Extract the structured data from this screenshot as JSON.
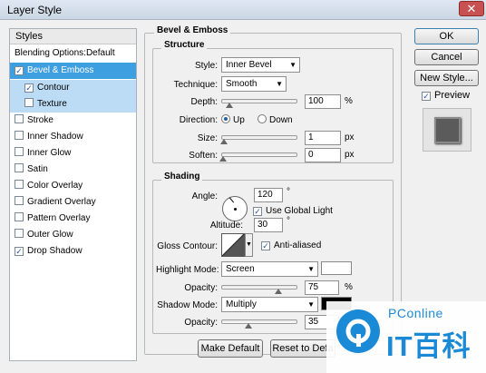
{
  "window": {
    "title": "Layer Style",
    "close_glyph": "✕"
  },
  "styles": {
    "header": "Styles",
    "blending_options": "Blending Options:Default",
    "items": [
      {
        "label": "Bevel & Emboss",
        "checked": true
      },
      {
        "label": "Contour",
        "checked": true
      },
      {
        "label": "Texture",
        "checked": false
      },
      {
        "label": "Stroke",
        "checked": false
      },
      {
        "label": "Inner Shadow",
        "checked": false
      },
      {
        "label": "Inner Glow",
        "checked": false
      },
      {
        "label": "Satin",
        "checked": false
      },
      {
        "label": "Color Overlay",
        "checked": false
      },
      {
        "label": "Gradient Overlay",
        "checked": false
      },
      {
        "label": "Pattern Overlay",
        "checked": false
      },
      {
        "label": "Outer Glow",
        "checked": false
      },
      {
        "label": "Drop Shadow",
        "checked": true
      }
    ]
  },
  "bevel": {
    "section_title": "Bevel & Emboss",
    "structure": {
      "title": "Structure",
      "style_label": "Style:",
      "style_value": "Inner Bevel",
      "technique_label": "Technique:",
      "technique_value": "Smooth",
      "depth_label": "Depth:",
      "depth_value": "100",
      "depth_unit": "%",
      "direction_label": "Direction:",
      "direction_up": "Up",
      "direction_down": "Down",
      "size_label": "Size:",
      "size_value": "1",
      "size_unit": "px",
      "soften_label": "Soften:",
      "soften_value": "0",
      "soften_unit": "px"
    },
    "shading": {
      "title": "Shading",
      "angle_label": "Angle:",
      "angle_value": "120",
      "angle_unit": "°",
      "global_light_label": "Use Global Light",
      "altitude_label": "Altitude:",
      "altitude_value": "30",
      "altitude_unit": "°",
      "gloss_label": "Gloss Contour:",
      "anti_aliased_label": "Anti-aliased",
      "highlight_mode_label": "Highlight Mode:",
      "highlight_mode_value": "Screen",
      "highlight_color": "#ffffff",
      "highlight_opacity_label": "Opacity:",
      "highlight_opacity_value": "75",
      "highlight_opacity_unit": "%",
      "shadow_mode_label": "Shadow Mode:",
      "shadow_mode_value": "Multiply",
      "shadow_color": "#000000",
      "shadow_opacity_label": "Opacity:",
      "shadow_opacity_value": "35"
    },
    "make_default": "Make Default",
    "reset_default": "Reset to Defa"
  },
  "buttons": {
    "ok": "OK",
    "cancel": "Cancel",
    "new_style": "New Style...",
    "preview": "Preview"
  },
  "watermark": {
    "top": "PConline",
    "bottom": "IT百科"
  },
  "colors": {
    "selection": "#3d9ee0",
    "sub_selection": "#bcdcf5",
    "watermark": "#1a8ad6"
  }
}
